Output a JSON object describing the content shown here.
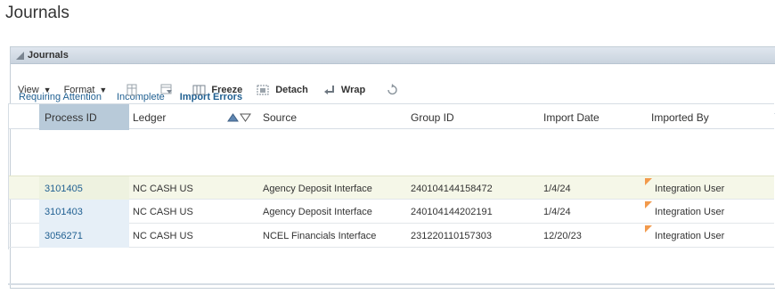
{
  "page": {
    "title": "Journals"
  },
  "panel": {
    "title": "Journals"
  },
  "tabs": [
    {
      "label": "Requiring Attention"
    },
    {
      "label": "Incomplete"
    },
    {
      "label": "Import Errors"
    }
  ],
  "toolbar": {
    "view": "View",
    "format": "Format",
    "freeze": "Freeze",
    "detach": "Detach",
    "wrap": "Wrap"
  },
  "table": {
    "headers": {
      "process_id": "Process ID",
      "ledger": "Ledger",
      "source": "Source",
      "group_id": "Group ID",
      "import_date": "Import Date",
      "imported_by": "Imported By"
    },
    "rows": [
      {
        "process_id": "3101405",
        "ledger": "NC CASH US",
        "source": "Agency Deposit Interface",
        "group_id": "240104144158472",
        "import_date": "1/4/24",
        "imported_by": "Integration User"
      },
      {
        "process_id": "3101403",
        "ledger": "NC CASH US",
        "source": "Agency Deposit Interface",
        "group_id": "240104144202191",
        "import_date": "1/4/24",
        "imported_by": "Integration User"
      },
      {
        "process_id": "3056271",
        "ledger": "NC CASH US",
        "source": "NCEL Financials Interface",
        "group_id": "231220110157303",
        "import_date": "12/20/23",
        "imported_by": "Integration User"
      }
    ]
  },
  "colors": {
    "link": "#1f5f91",
    "accent": "#4a90c6",
    "selected_row": "#f5f7e8",
    "flag": "#f29a4c"
  }
}
